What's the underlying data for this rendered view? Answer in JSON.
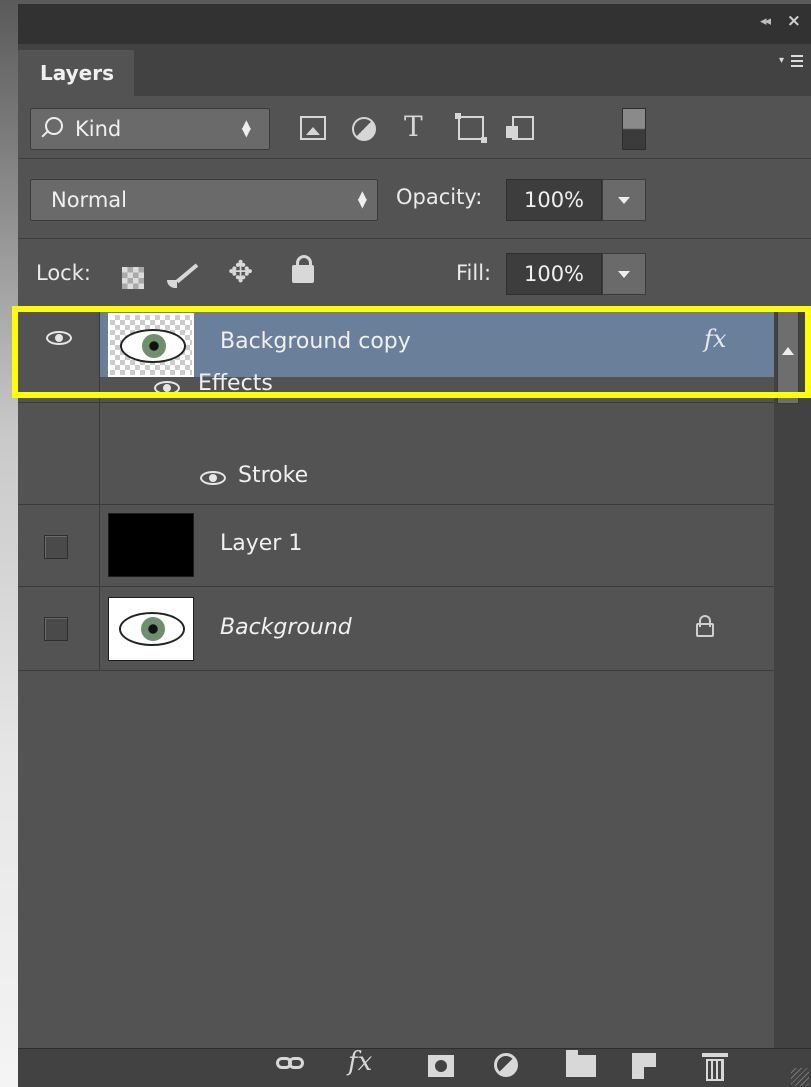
{
  "panel": {
    "tab_label": "Layers",
    "collapse_glyph": "◂◂",
    "close_glyph": "×"
  },
  "filter": {
    "kind_label": "Kind",
    "icons": [
      "pixel-filter-icon",
      "adjustment-filter-icon",
      "type-filter-icon",
      "shape-filter-icon",
      "smart-object-filter-icon",
      "filter-toggle-icon"
    ]
  },
  "blend": {
    "mode": "Normal",
    "opacity_label": "Opacity:",
    "opacity_value": "100%"
  },
  "lock": {
    "label": "Lock:",
    "fill_label": "Fill:",
    "fill_value": "100%",
    "move_glyph": "✥"
  },
  "layers": [
    {
      "name": "Background copy",
      "visible": true,
      "selected": true,
      "has_fx": true,
      "fx_label": "fx"
    },
    {
      "name": "Effects",
      "effect_header": true,
      "visible": true
    },
    {
      "name": "Stroke",
      "effect": true,
      "visible": true
    },
    {
      "name": "Layer 1",
      "visible": false
    },
    {
      "name": "Background",
      "visible": false,
      "italic": true,
      "locked": true
    }
  ],
  "footer": {
    "fx_label": "fx",
    "icons": [
      "link-layers-icon",
      "add-style-icon",
      "add-mask-icon",
      "adjustment-layer-icon",
      "group-icon",
      "new-layer-icon",
      "delete-icon"
    ]
  },
  "colors": {
    "panel_bg": "#535353",
    "selected_row": "#6a7f9a",
    "highlight": "#ffff00"
  }
}
